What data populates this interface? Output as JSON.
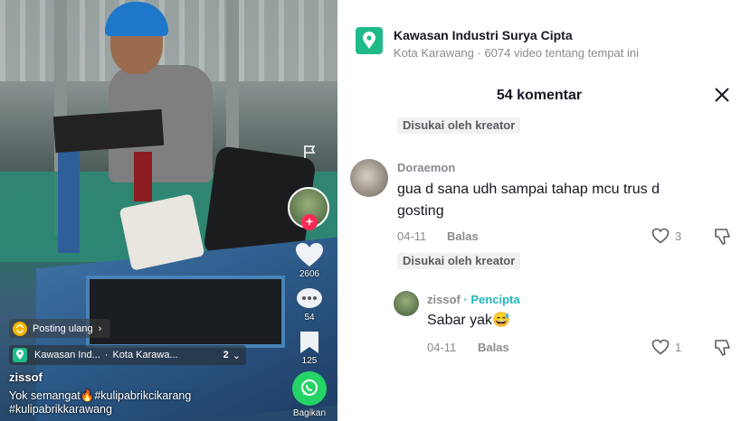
{
  "video": {
    "side_counts": {
      "likes": "2606",
      "comments": "54",
      "saves": "125"
    },
    "share_label": "Bagikan",
    "repost_label": "Posting ulang",
    "location": {
      "name": "Kawasan Ind...",
      "city": "Kota Karawa...",
      "count": "2"
    },
    "author": "zissof",
    "caption": "Yok semangat🔥#kulipabrikcikarang #kulipabrikkarawang"
  },
  "panel": {
    "location_title": "Kawasan Industri Surya Cipta",
    "location_subtitle": "Kota Karawang · 6074 video tentang tempat ini",
    "comments_title": "54 komentar",
    "liked_by_creator": "Disukai oleh kreator",
    "comments": [
      {
        "username": "Doraemon",
        "text": "gua d sana udh sampai tahap mcu trus d gosting",
        "date": "04-11",
        "reply_label": "Balas",
        "likes": "3",
        "liked_by_creator": "Disukai oleh kreator"
      },
      {
        "username": "zissof",
        "creator_tag": "Pencipta",
        "text": "Sabar yak😅",
        "date": "04-11",
        "reply_label": "Balas",
        "likes": "1"
      }
    ]
  },
  "colors": {
    "accent_red": "#fe2c55",
    "location_green": "#20b98a",
    "creator_teal": "#20b5bd"
  }
}
